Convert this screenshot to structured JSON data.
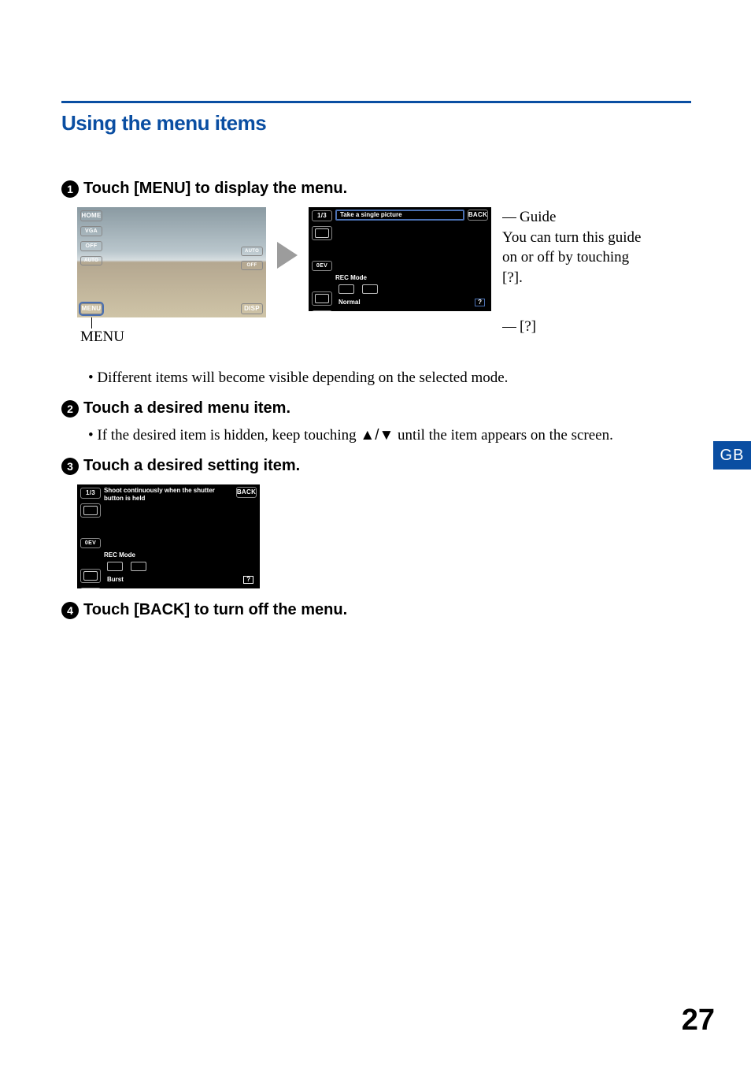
{
  "heading": "Using the menu items",
  "steps": {
    "1": {
      "num": "1",
      "title": "Touch [MENU] to display the menu."
    },
    "2": {
      "num": "2",
      "title": "Touch a desired menu item."
    },
    "3": {
      "num": "3",
      "title": "Touch a desired setting item."
    },
    "4": {
      "num": "4",
      "title": "Touch [BACK] to turn off the menu."
    }
  },
  "bullets": {
    "b1": "Different items will become visible depending on on the selected mode.",
    "b1_fix": "Different items will become visible depending on the selected mode.",
    "b2_pre": "If the desired item is hidden, keep touching ",
    "b2_arrows": "▲/▼",
    "b2_post": " until the item appears on the screen."
  },
  "lcdA": {
    "home": "HOME",
    "vga": "VGA",
    "off": "OFF",
    "auto1": "AUTO",
    "auto2": "AUTO",
    "off2": "OFF",
    "menu": "MENU",
    "disp": "DISP"
  },
  "lcdB": {
    "page": "1/3",
    "tip": "Take a single picture",
    "back": "BACK",
    "ev": "0EV",
    "section": "REC Mode",
    "status": "Normal",
    "help": "?"
  },
  "lcdC": {
    "page": "1/3",
    "tip": "Shoot continuously when the shutter button is held",
    "back": "BACK",
    "ev": "0EV",
    "section": "REC Mode",
    "status": "Burst",
    "help": "?"
  },
  "menu_caption": "MENU",
  "guide": {
    "title": "Guide",
    "body": "You can turn this guide on or off by touching [?].",
    "q": "[?]"
  },
  "tab": "GB",
  "page_number": "27"
}
